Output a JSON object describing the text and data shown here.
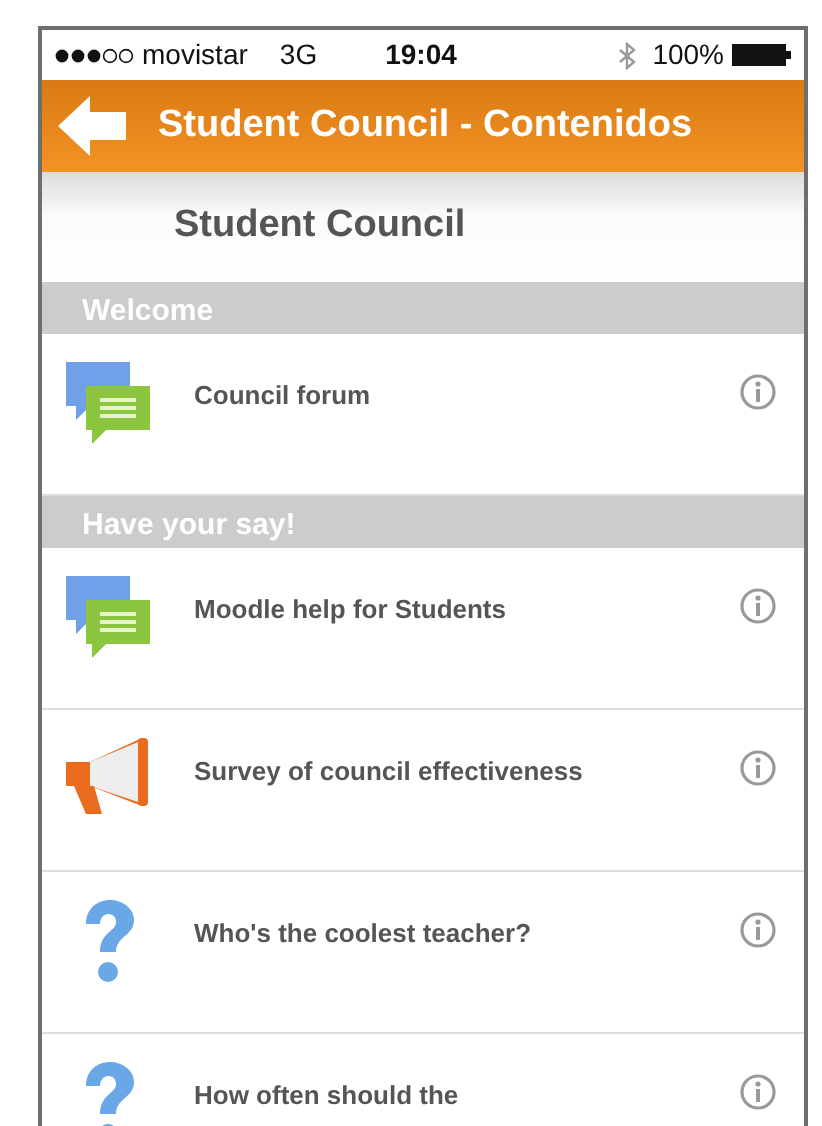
{
  "status_bar": {
    "carrier": "movistar",
    "network": "3G",
    "time": "19:04",
    "battery": "100%"
  },
  "header": {
    "title": "Student Council - Contenidos"
  },
  "course_title": "Student Council",
  "sections": [
    {
      "title": "Welcome",
      "items": [
        {
          "kind": "forum",
          "label": "Council forum"
        }
      ]
    },
    {
      "title": "Have your say!",
      "items": [
        {
          "kind": "forum",
          "label": "Moodle help for Students"
        },
        {
          "kind": "feedback",
          "label": "Survey of council effectiveness"
        },
        {
          "kind": "choice",
          "label": "Who's the coolest teacher?"
        },
        {
          "kind": "choice",
          "label": "How often should the"
        }
      ]
    }
  ]
}
